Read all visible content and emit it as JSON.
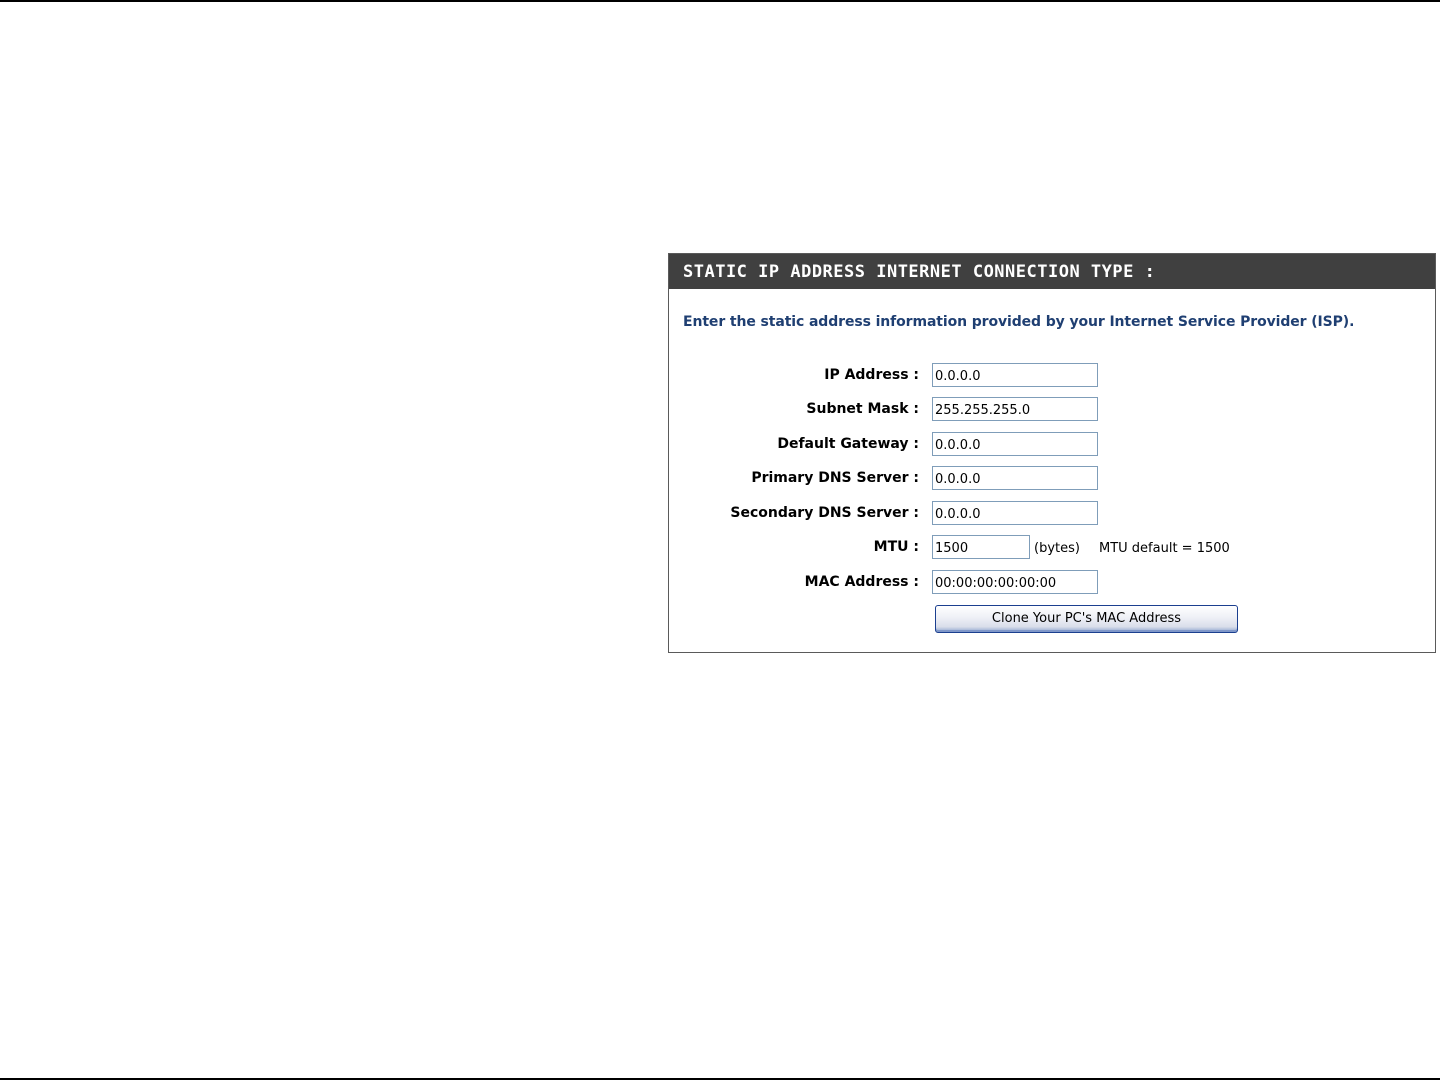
{
  "panel": {
    "title": "STATIC IP ADDRESS INTERNET CONNECTION TYPE :",
    "intro": "Enter the static address information provided by your Internet Service Provider (ISP)."
  },
  "fields": {
    "ip_address": {
      "label": "IP Address :",
      "value": "0.0.0.0"
    },
    "subnet_mask": {
      "label": "Subnet Mask :",
      "value": "255.255.255.0"
    },
    "default_gateway": {
      "label": "Default Gateway :",
      "value": "0.0.0.0"
    },
    "primary_dns": {
      "label": "Primary DNS Server :",
      "value": "0.0.0.0"
    },
    "secondary_dns": {
      "label": "Secondary DNS Server :",
      "value": "0.0.0.0"
    },
    "mtu": {
      "label": "MTU :",
      "value": "1500",
      "unit": "(bytes)",
      "note": "MTU default = 1500"
    },
    "mac_address": {
      "label": "MAC Address :",
      "value": "00:00:00:00:00:00"
    }
  },
  "actions": {
    "clone_mac_label": "Clone Your PC's MAC Address"
  }
}
